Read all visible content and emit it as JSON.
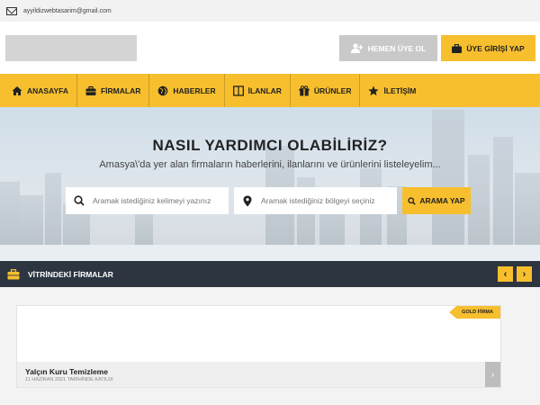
{
  "topbar": {
    "email": "ayyildizwebtasarim@gmail.com"
  },
  "header": {
    "register_label": "HEMEN ÜYE OL",
    "login_label": "ÜYE GİRİŞİ YAP"
  },
  "nav": {
    "items": [
      {
        "label": "ANASAYFA",
        "icon": "home-icon"
      },
      {
        "label": "FİRMALAR",
        "icon": "briefcase-icon"
      },
      {
        "label": "HABERLER",
        "icon": "globe-icon"
      },
      {
        "label": "İLANLAR",
        "icon": "columns-icon"
      },
      {
        "label": "ÜRÜNLER",
        "icon": "gift-icon"
      },
      {
        "label": "İLETİŞİM",
        "icon": "star-icon"
      }
    ]
  },
  "hero": {
    "title": "NASIL YARDIMCI OLABİLİRİZ?",
    "subtitle": "Amasya\\'da yer alan firmaların haberlerini, ilanlarını ve ürünlerini listeleyelim...",
    "keyword_placeholder": "Aramak istediğiniz kelimeyi yazınız",
    "location_placeholder": "Aramak istediğiniz bölgeyi seçiniz",
    "search_label": "ARAMA YAP"
  },
  "vitrin": {
    "title": "VİTRİNDEKİ FİRMALAR",
    "prev": "‹",
    "next": "›"
  },
  "card": {
    "badge": "GOLD FİRMA",
    "name": "Yalçın Kuru Temizleme",
    "date": "11 HAZİRAN 2021 TARİHİNDE KATILDI",
    "arrow": "›"
  },
  "colors": {
    "accent": "#f7bf2e",
    "dark_bar": "#2c3540",
    "muted_button": "#c9c9c9"
  }
}
